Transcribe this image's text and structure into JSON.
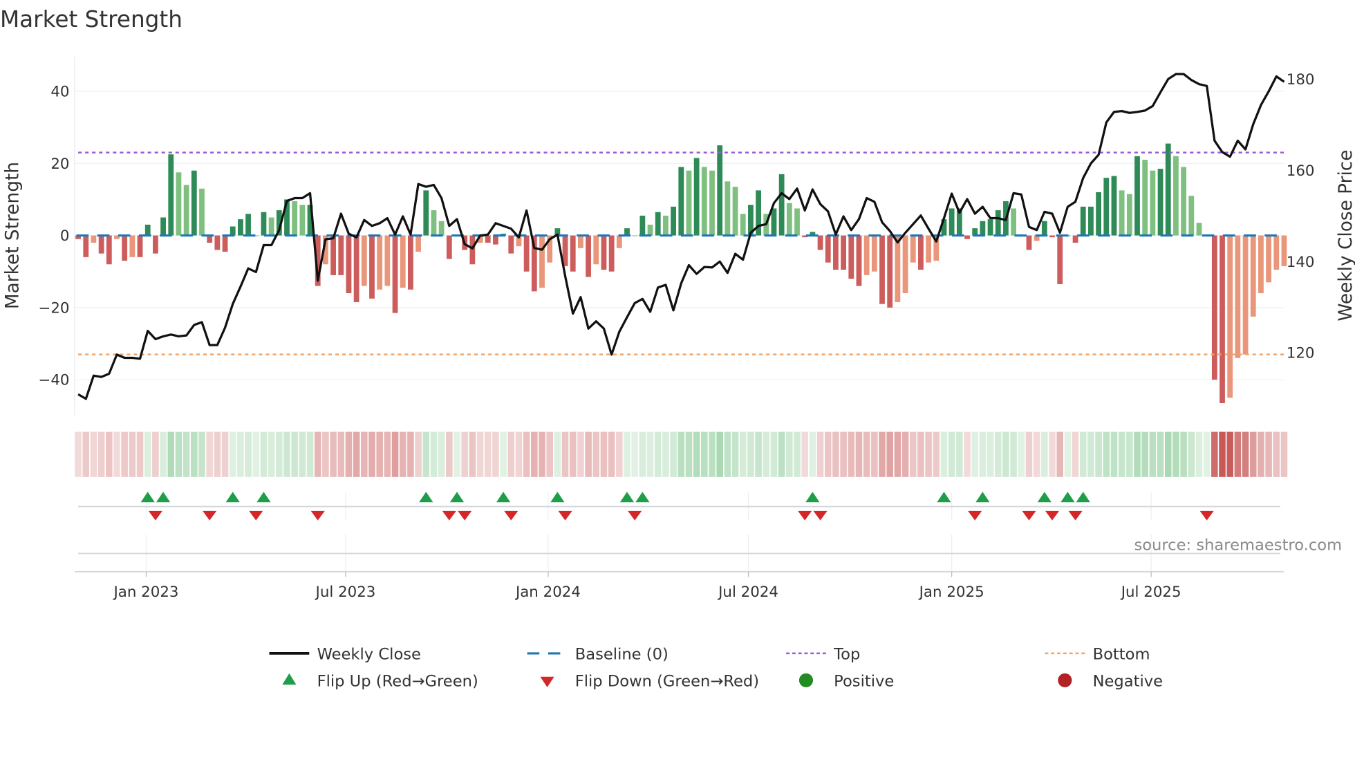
{
  "title": "Market Strength",
  "source": "source: sharemaestro.com",
  "colors": {
    "pos_strong": "#2e8b57",
    "pos_weak": "#7fbf7f",
    "neg_strong": "#cd5c5c",
    "neg_weak": "#e9967a",
    "close": "#111111",
    "baseline": "#1f77b4",
    "top": "#9b59d9",
    "bottom": "#f0a468",
    "flip_up": "#1f9e4a",
    "flip_down": "#d62728",
    "positive": "#228b22",
    "negative": "#b22222"
  },
  "chart_data": {
    "type": "bar",
    "title": "Market Strength",
    "ylabel": "Market Strength",
    "y2label": "Weekly Close Price",
    "ylim": [
      -50,
      50
    ],
    "y2lim": [
      107,
      185
    ],
    "yticks": [
      {
        "value": 40,
        "label": "40"
      },
      {
        "value": 20,
        "label": "20"
      },
      {
        "value": 0,
        "label": "0"
      },
      {
        "value": -20,
        "label": "−20"
      },
      {
        "value": -40,
        "label": "−40"
      }
    ],
    "y2ticks": [
      {
        "value": 180,
        "label": "180"
      },
      {
        "value": 160,
        "label": "160"
      },
      {
        "value": 140,
        "label": "140"
      },
      {
        "value": 120,
        "label": "120"
      }
    ],
    "xticks": [
      {
        "week": 8.8,
        "label": "Jan 2023"
      },
      {
        "week": 34.6,
        "label": "Jul 2023"
      },
      {
        "week": 60.8,
        "label": "Jan 2024"
      },
      {
        "week": 86.7,
        "label": "Jul 2024"
      },
      {
        "week": 113.0,
        "label": "Jan 2025"
      },
      {
        "week": 138.8,
        "label": "Jul 2025"
      }
    ],
    "top_level": 23,
    "bottom_level": -33,
    "baseline": 0,
    "strength": [
      -1,
      -6,
      -2,
      -5,
      -8,
      -1,
      -7,
      -6,
      -6,
      3,
      -5,
      5,
      22.5,
      17.5,
      14,
      18,
      13,
      -2,
      -4,
      -4.5,
      2.5,
      4.5,
      6,
      0,
      6.5,
      5,
      7,
      10,
      9.5,
      8.5,
      8.5,
      -14,
      -8,
      -11,
      -11,
      -16,
      -18.5,
      -14,
      -17.5,
      -15,
      -14,
      -21.5,
      -14.5,
      -15,
      -4.5,
      12.5,
      7,
      4,
      -6.5,
      0,
      -4,
      -8,
      -2,
      -2,
      -2.5,
      0.5,
      -5,
      -3,
      -10,
      -15.5,
      -14.5,
      -7.5,
      2,
      -8.5,
      -10,
      -3.5,
      -11.5,
      -8,
      -9.5,
      -10,
      -3.5,
      2,
      0,
      5.5,
      3,
      6.5,
      5.5,
      8,
      19,
      18,
      21.5,
      19,
      18,
      25,
      15,
      13.5,
      6,
      8.5,
      12.5,
      6,
      7.5,
      17,
      9,
      7.5,
      -0.5,
      1,
      -4,
      -7.5,
      -9.5,
      -9.5,
      -12,
      -14,
      -11,
      -10,
      -19,
      -20,
      -18.5,
      -16,
      -7.5,
      -9.5,
      -7.5,
      -7,
      4.5,
      7.5,
      7.5,
      -1,
      2,
      4,
      4.5,
      7,
      9.5,
      7.5,
      0,
      -4,
      -1.5,
      4,
      -0.5,
      -13.5,
      0,
      -2,
      8,
      8,
      12,
      16,
      16.5,
      12.5,
      11.5,
      22,
      21,
      18,
      18.5,
      25.5,
      22,
      19,
      11,
      3.5,
      0,
      -40,
      -46.5,
      -45,
      -34,
      -33,
      -22.5,
      -16,
      -13,
      -9.5,
      -8.5
    ],
    "close": [
      110.9,
      109.9,
      115,
      114.7,
      115.4,
      119.6,
      118.9,
      118.9,
      118.7,
      124.8,
      123,
      123.6,
      124,
      123.6,
      123.8,
      126.1,
      126.7,
      121.7,
      121.7,
      125.5,
      130.7,
      134.5,
      138.5,
      137.7,
      143.6,
      143.6,
      146.9,
      153.3,
      153.9,
      153.9,
      155,
      135.8,
      144.9,
      145.1,
      150.5,
      146.1,
      145.3,
      149.1,
      147.8,
      148.4,
      149.5,
      145.9,
      149.9,
      145.9,
      157,
      156.4,
      156.8,
      153.9,
      147.8,
      149.3,
      143.8,
      142.9,
      145.7,
      145.9,
      148.4,
      147.8,
      147.2,
      145.3,
      151.2,
      143,
      142.6,
      144.9,
      145.9,
      136.8,
      128.6,
      132.2,
      125.3,
      126.9,
      125.3,
      119.6,
      124.6,
      127.8,
      130.9,
      131.8,
      129,
      134.3,
      134.9,
      129.3,
      135.2,
      139.2,
      137.3,
      138.8,
      138.7,
      140,
      137.5,
      141.7,
      140.4,
      146.3,
      147.8,
      148.2,
      152.8,
      155,
      153.7,
      156,
      151.2,
      155.8,
      152.6,
      151,
      145.9,
      149.9,
      146.9,
      149.3,
      153.9,
      153.1,
      148.6,
      146.7,
      144.2,
      146.3,
      148.2,
      150.1,
      147.2,
      144.4,
      149.5,
      154.9,
      150.7,
      153.7,
      150.5,
      152,
      149.5,
      149.5,
      149.1,
      155,
      154.7,
      147.6,
      146.9,
      150.9,
      150.5,
      146.3,
      152,
      153.1,
      158.3,
      161.5,
      163.4,
      170.5,
      172.8,
      173,
      172.6,
      172.8,
      173.1,
      174.1,
      177.1,
      180,
      181.1,
      181.1,
      179.8,
      178.9,
      178.5,
      166.5,
      164,
      163,
      166.5,
      164.6,
      170.1,
      174.3,
      177.3,
      180.6,
      179.4
    ],
    "flip_up_weeks": [
      9,
      11,
      20,
      24,
      45,
      49,
      55,
      62,
      71,
      73,
      95,
      112,
      117,
      125,
      128,
      130
    ],
    "flip_down_weeks": [
      10,
      17,
      23,
      31,
      48,
      50,
      56,
      63,
      72,
      94,
      96,
      116,
      123,
      126,
      129,
      146
    ],
    "legend": [
      {
        "key": "close",
        "label": "Weekly Close"
      },
      {
        "key": "baseline",
        "label": "Baseline (0)"
      },
      {
        "key": "top",
        "label": "Top"
      },
      {
        "key": "bottom",
        "label": "Bottom"
      },
      {
        "key": "flip_up",
        "label": "Flip Up (Red→Green)"
      },
      {
        "key": "flip_down",
        "label": "Flip Down (Green→Red)"
      },
      {
        "key": "positive",
        "label": "Positive"
      },
      {
        "key": "negative",
        "label": "Negative"
      }
    ],
    "legend_position": "bottom-center",
    "grid": true
  }
}
